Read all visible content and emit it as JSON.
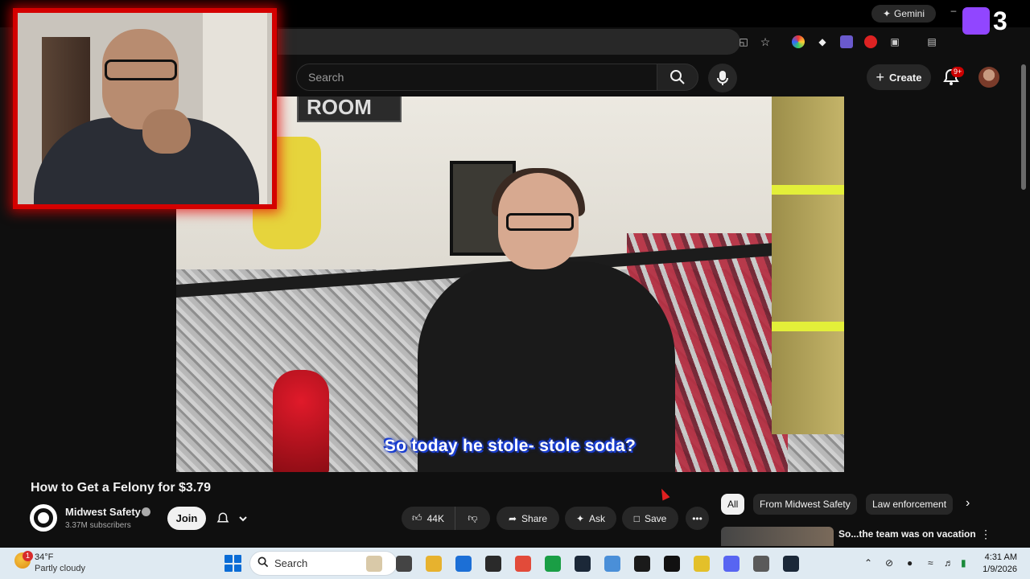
{
  "browser": {
    "gemini_label": "Gemini",
    "minimize_label": "–",
    "extensions": [
      "screen-share-icon",
      "star-icon",
      "color-extension-icon",
      "diamond-extension-icon",
      "twitch-extension-icon",
      "red-extension-icon",
      "puzzle-icon",
      "sidebar-icon"
    ]
  },
  "twitch_overlay": {
    "count": "3"
  },
  "youtube": {
    "search_placeholder": "Search",
    "create_label": "Create",
    "notification_count": "9+"
  },
  "video": {
    "caption": "So today he stole- stole soda?",
    "sign_text": "ROOM",
    "title": "How to Get a Felony for $3.79"
  },
  "channel": {
    "name": "Midwest Safety",
    "subscribers": "3.37M subscribers",
    "join_label": "Join"
  },
  "actions": {
    "likes": "44K",
    "share_label": "Share",
    "ask_label": "Ask",
    "save_label": "Save",
    "more_label": "•••"
  },
  "chips": {
    "all": "All",
    "from_channel": "From Midwest Safety",
    "law": "Law enforcement",
    "next": "›"
  },
  "recommendation": {
    "title": "So...the team was on vacation",
    "more": "⋮"
  },
  "taskbar": {
    "weather_badge": "1",
    "temperature": "34°F",
    "weather_desc": "Partly cloudy",
    "search_label": "Search",
    "time": "4:31 AM",
    "date": "1/9/2026",
    "app_colors": [
      "#d9c9a8",
      "#444444",
      "#e7b22e",
      "#1c6fd6",
      "#2a2a2a",
      "#e24b3a",
      "#1a9e45",
      "#1b2838",
      "#4a8fd8",
      "#1a1a1a",
      "#111111",
      "#e3c02a",
      "#5865f2",
      "#5a5a5a",
      "#1b2838"
    ]
  }
}
